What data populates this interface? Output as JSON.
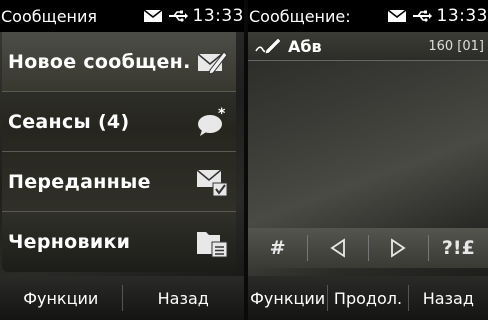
{
  "left_screen": {
    "status_title": "Сообщения",
    "time": "13:33",
    "menu_items": [
      {
        "label": "Новое сообщен.",
        "icon": "compose-icon"
      },
      {
        "label": "Сеансы (4)",
        "icon": "chat-bubble-icon"
      },
      {
        "label": "Переданные",
        "icon": "sent-mail-icon"
      },
      {
        "label": "Черновики",
        "icon": "drafts-folder-icon"
      }
    ],
    "softkeys": {
      "left": "Функции",
      "right": "Назад"
    }
  },
  "right_screen": {
    "status_title": "Сообщение:",
    "time": "13:33",
    "input_mode": "Абв",
    "char_counter": "160 [01]",
    "toolbar": [
      "#",
      "◁",
      "▷",
      "?!£"
    ],
    "softkeys": {
      "left": "Функции",
      "middle": "Продол.",
      "right": "Назад"
    }
  },
  "colors": {
    "background": "#000000",
    "text": "#ffffff",
    "separator": "#5a5a55"
  }
}
